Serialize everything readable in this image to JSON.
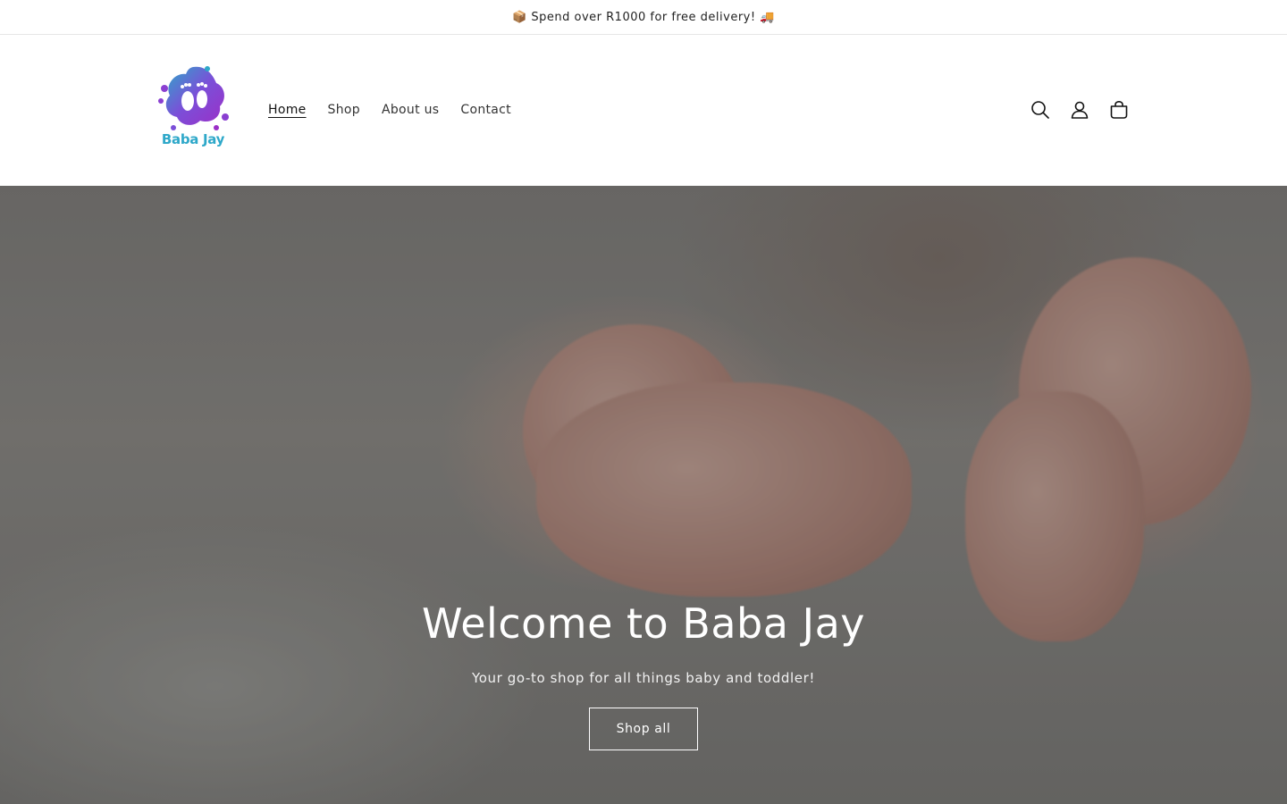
{
  "announcement": {
    "text": "📦 Spend over R1000 for free delivery! 🚚"
  },
  "header": {
    "logo_text": "Baba Jay",
    "nav": [
      {
        "label": "Home",
        "active": true
      },
      {
        "label": "Shop",
        "active": false
      },
      {
        "label": "About us",
        "active": false
      },
      {
        "label": "Contact",
        "active": false
      }
    ],
    "icons": [
      "search-icon",
      "account-icon",
      "cart-icon"
    ]
  },
  "hero": {
    "title": "Welcome to Baba Jay",
    "subtitle": "Your go-to shop for all things baby and toddler!",
    "button_label": "Shop all"
  },
  "colors": {
    "logo_blue": "#2ea8c9",
    "logo_purple": "#8a3fd1",
    "text": "#121212"
  }
}
